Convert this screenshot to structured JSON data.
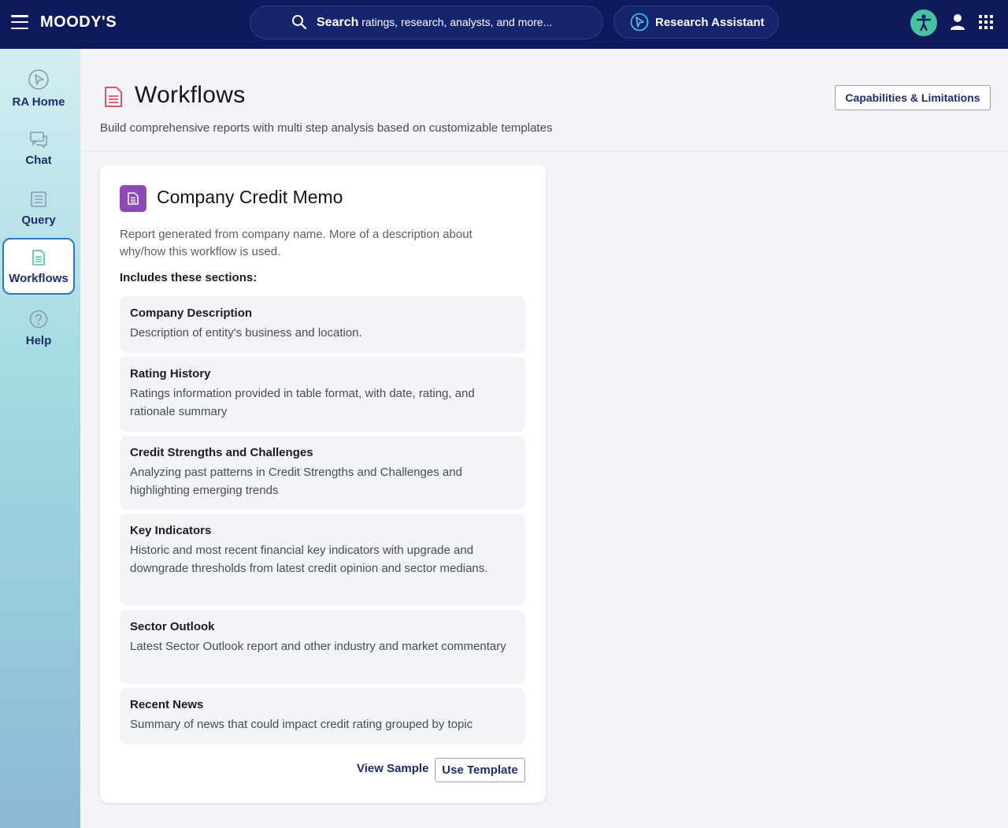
{
  "topbar": {
    "brand": "MOODY'S",
    "search": {
      "strong": "Search",
      "rest": " ratings, research, analysts, and more..."
    },
    "research_assistant": "Research Assistant",
    "icons": {
      "menu": "hamburger-icon",
      "search": "search-icon",
      "ra": "research-assistant-icon",
      "accessibility": "accessibility-icon",
      "user": "user-icon",
      "apps": "apps-grid-icon"
    },
    "colors": {
      "bar": "#0e1a5c",
      "accessibility": "#48c1a0"
    }
  },
  "sidebar": {
    "items": [
      {
        "label": "RA Home",
        "icon": "ra-home-icon"
      },
      {
        "label": "Chat",
        "icon": "chat-icon"
      },
      {
        "label": "Query",
        "icon": "query-icon"
      },
      {
        "label": "Workflows",
        "icon": "workflows-icon",
        "active": true
      },
      {
        "label": "Help",
        "icon": "help-icon"
      }
    ]
  },
  "header": {
    "title": "Workflows",
    "subtitle": "Build comprehensive reports with multi step analysis based on customizable templates",
    "capabilities_button": "Capabilities & Limitations"
  },
  "card": {
    "title": "Company Credit Memo",
    "description": "Report generated from company name. More of a description about why/how this workflow is used.",
    "includes_label": "Includes these sections:",
    "sections": [
      {
        "title": "Company Description",
        "description": "Description of entity's business and location."
      },
      {
        "title": "Rating History",
        "description": "Ratings information provided in table format, with date, rating, and rationale summary"
      },
      {
        "title": "Credit Strengths and Challenges",
        "description": "Analyzing past patterns in Credit Strengths and Challenges and highlighting emerging trends"
      },
      {
        "title": "Key Indicators",
        "description": "Historic and most recent financial key indicators with upgrade and downgrade thresholds from latest credit opinion and sector medians."
      },
      {
        "title": "Sector Outlook",
        "description": "Latest Sector Outlook report and other industry and market commentary"
      },
      {
        "title": "Recent News",
        "description": "Summary of news that could impact credit rating grouped by topic"
      }
    ],
    "view_sample": "View Sample",
    "use_template": "Use Template",
    "accent_color": "#8c4bb4"
  }
}
